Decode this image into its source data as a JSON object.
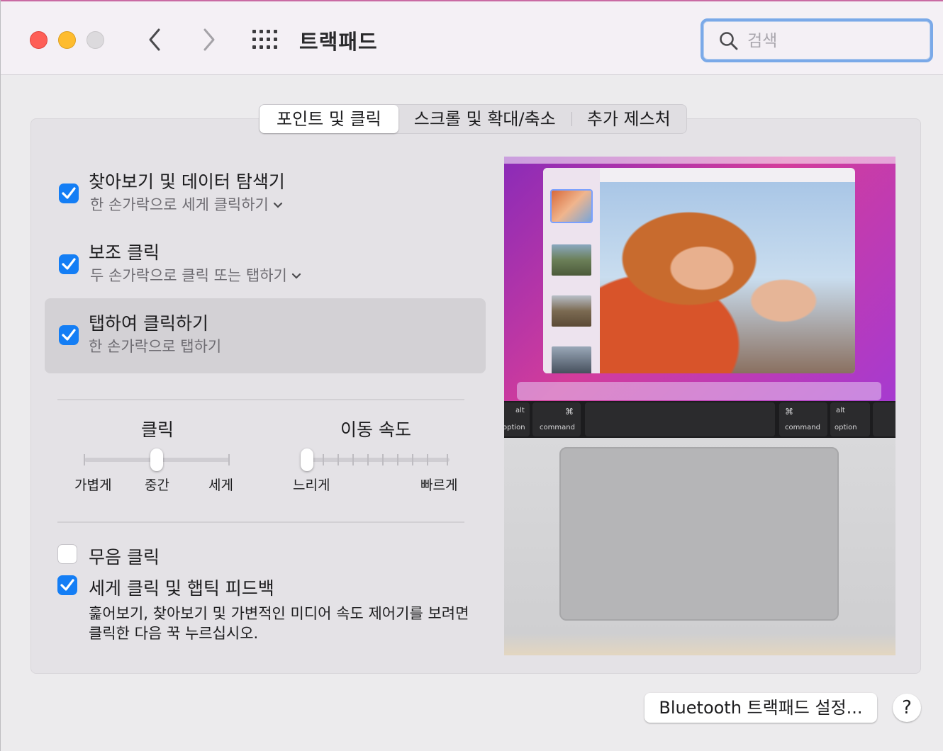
{
  "window": {
    "title": "트랙패드"
  },
  "search": {
    "placeholder": "검색",
    "value": ""
  },
  "tabs": [
    {
      "label": "포인트 및 클릭",
      "active": true
    },
    {
      "label": "스크롤 및 확대/축소",
      "active": false
    },
    {
      "label": "추가 제스처",
      "active": false
    }
  ],
  "options": {
    "lookup": {
      "title": "찾아보기 및 데이터 탐색기",
      "subtitle": "한 손가락으로 세게 클릭하기",
      "checked": true
    },
    "secondary": {
      "title": "보조 클릭",
      "subtitle": "두 손가락으로 클릭 또는 탭하기",
      "checked": true
    },
    "tap": {
      "title": "탭하여 클릭하기",
      "subtitle": "한 손가락으로 탭하기",
      "checked": true
    },
    "silent": {
      "title": "무음 클릭",
      "checked": false
    },
    "force": {
      "title": "세게 클릭 및 햅틱 피드백",
      "checked": true,
      "description": "훑어보기, 찾아보기 및 가변적인 미디어 속도 제어기를 보려면 클릭한 다음 꾹 누르십시오."
    }
  },
  "click_slider": {
    "title": "클릭",
    "labels": [
      "가볍게",
      "중간",
      "세게"
    ],
    "value": "중간"
  },
  "speed_slider": {
    "title": "이동 속도",
    "min_label": "느리게",
    "max_label": "빠르게",
    "value_fraction": 0.0
  },
  "preview_keys": {
    "alt": "alt",
    "option": "option",
    "command": "command",
    "cmd_symbol": "⌘"
  },
  "footer": {
    "bluetooth_button": "Bluetooth 트랙패드 설정...",
    "help": "?"
  },
  "colors": {
    "accent": "#147ef5",
    "close": "#fe5f57",
    "minimize": "#febc2e"
  }
}
